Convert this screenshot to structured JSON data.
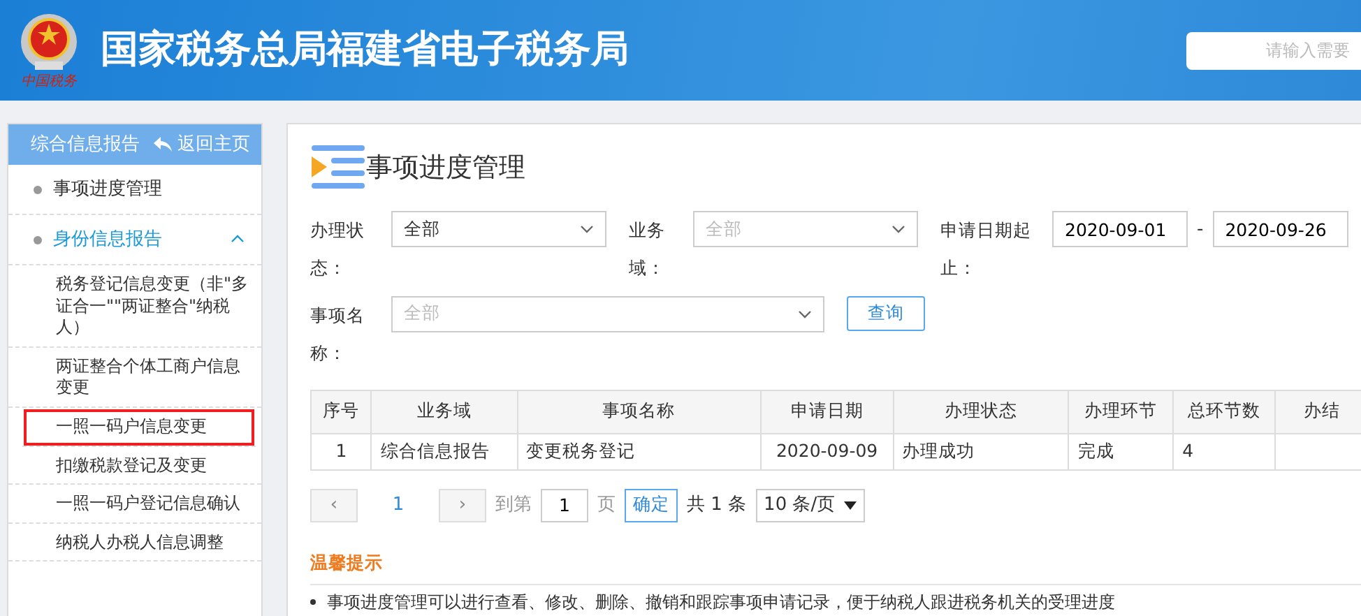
{
  "header": {
    "emblem_caption": "中国税务",
    "title": "国家税务总局福建省电子税务局",
    "search": {
      "placeholder": "请输入需要"
    }
  },
  "sidebar": {
    "section": "综合信息报告",
    "back": "返回主页",
    "items": [
      {
        "label": "事项进度管理",
        "selected": false
      },
      {
        "label": "身份信息报告",
        "selected": true,
        "expanded": true,
        "children": [
          {
            "label": "税务登记信息变更（非\"多证合一\"\"两证整合\"纳税人）",
            "highlighted": false
          },
          {
            "label": "两证整合个体工商户信息变更",
            "highlighted": false
          },
          {
            "label": "一照一码户信息变更",
            "highlighted": true
          },
          {
            "label": "扣缴税款登记及变更",
            "highlighted": false
          },
          {
            "label": "一照一码户登记信息确认",
            "highlighted": false
          },
          {
            "label": "纳税人办税人信息调整",
            "highlighted": false
          }
        ]
      }
    ]
  },
  "main": {
    "title": "事项进度管理",
    "filters": [
      {
        "kind": "select",
        "label": "办理状态：",
        "value": "全部",
        "disabled": false
      },
      {
        "kind": "select",
        "label": "业务域：",
        "placeholder": "全部",
        "disabled": true
      },
      {
        "kind": "daterange",
        "label": "申请日期起止：",
        "from": "2020-09-01",
        "separator": "-",
        "to": "2020-09-26"
      },
      {
        "kind": "select",
        "label": "事项名称：",
        "placeholder": "全部",
        "disabled": true
      }
    ],
    "query_button": "查询",
    "table": {
      "columns": [
        "序号",
        "业务域",
        "事项名称",
        "申请日期",
        "办理状态",
        "办理环节",
        "总环节数",
        "办结"
      ],
      "rows": [
        [
          "1",
          "综合信息报告",
          "变更税务登记",
          "2020-09-09",
          "办理成功",
          "完成",
          "4",
          ""
        ]
      ]
    },
    "pagination": {
      "prev": "‹",
      "pages": [
        {
          "label": "1",
          "selected": true
        }
      ],
      "next": "›",
      "goto_label": "到第",
      "goto_value": "1",
      "page_label": "页",
      "confirm": "确定",
      "total": "共 1 条",
      "page_size": "10 条/页"
    },
    "tips": {
      "title": "温馨提示",
      "items": [
        "事项进度管理可以进行查看、修改、删除、撤销和跟踪事项申请记录，便于纳税人跟进税务机关的受理进度"
      ]
    }
  }
}
